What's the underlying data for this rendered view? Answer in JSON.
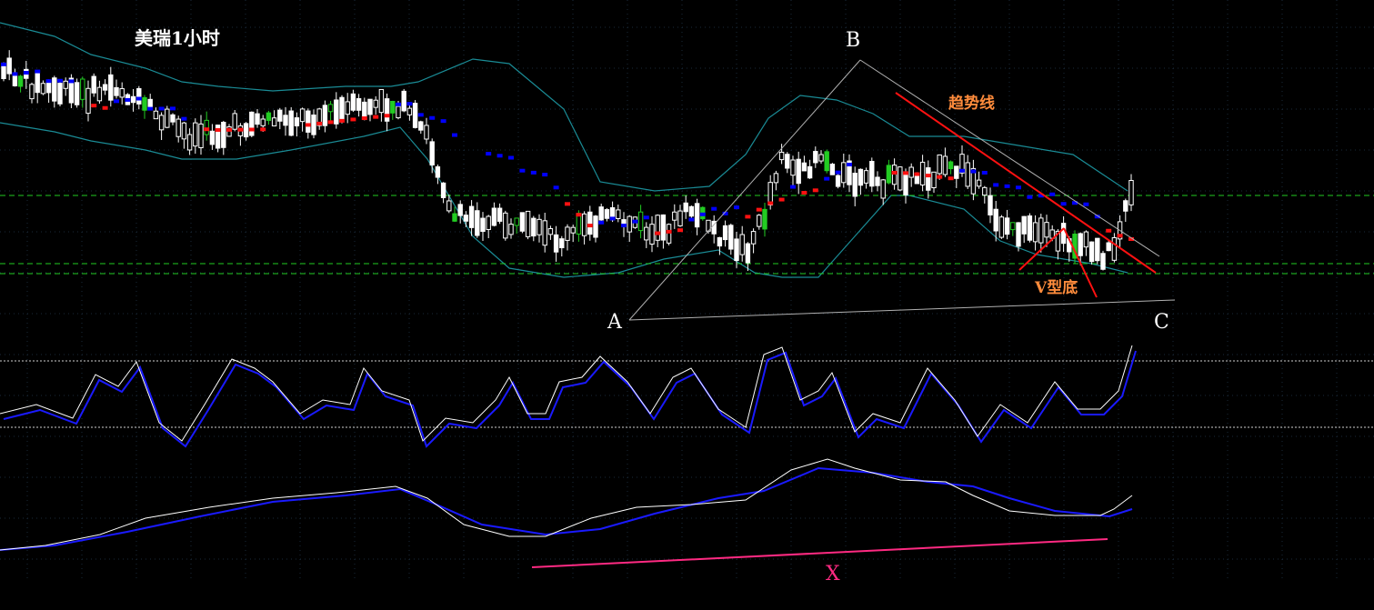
{
  "title": "美瑞1小时",
  "points": {
    "a": "A",
    "b": "B",
    "c": "C"
  },
  "annotations": {
    "trendline": "趋势线",
    "v_bottom": "V型底",
    "x": "X"
  },
  "colors": {
    "background": "#000000",
    "up_candle": "#ffffff",
    "down_candle": "#ffffff",
    "green_candle": "#22cc22",
    "trend_down_marker": "#0000ff",
    "trend_up_marker": "#ff1111",
    "bollinger": "#1a8b95",
    "grid": "#1a2a3a",
    "support_lines": "#22cc22",
    "trendline": "#ff1111",
    "osc_fast": "#ffffff",
    "osc_slow": "#1a1aff",
    "divergence_line": "#ff2a82"
  },
  "chart_data": {
    "type": "candlestick",
    "panels": [
      "price",
      "oscillator",
      "momentum"
    ],
    "series": [
      {
        "name": "",
        "kind": "candles"
      },
      {
        "name": "",
        "kind": "bollinger_bands"
      },
      {
        "name": "",
        "kind": "oscillator_fast"
      },
      {
        "name": "",
        "kind": "oscillator_slow"
      },
      {
        "name": "",
        "kind": "momentum_fast"
      },
      {
        "name": "",
        "kind": "momentum_slow"
      }
    ],
    "grid": true,
    "legend": "none"
  }
}
